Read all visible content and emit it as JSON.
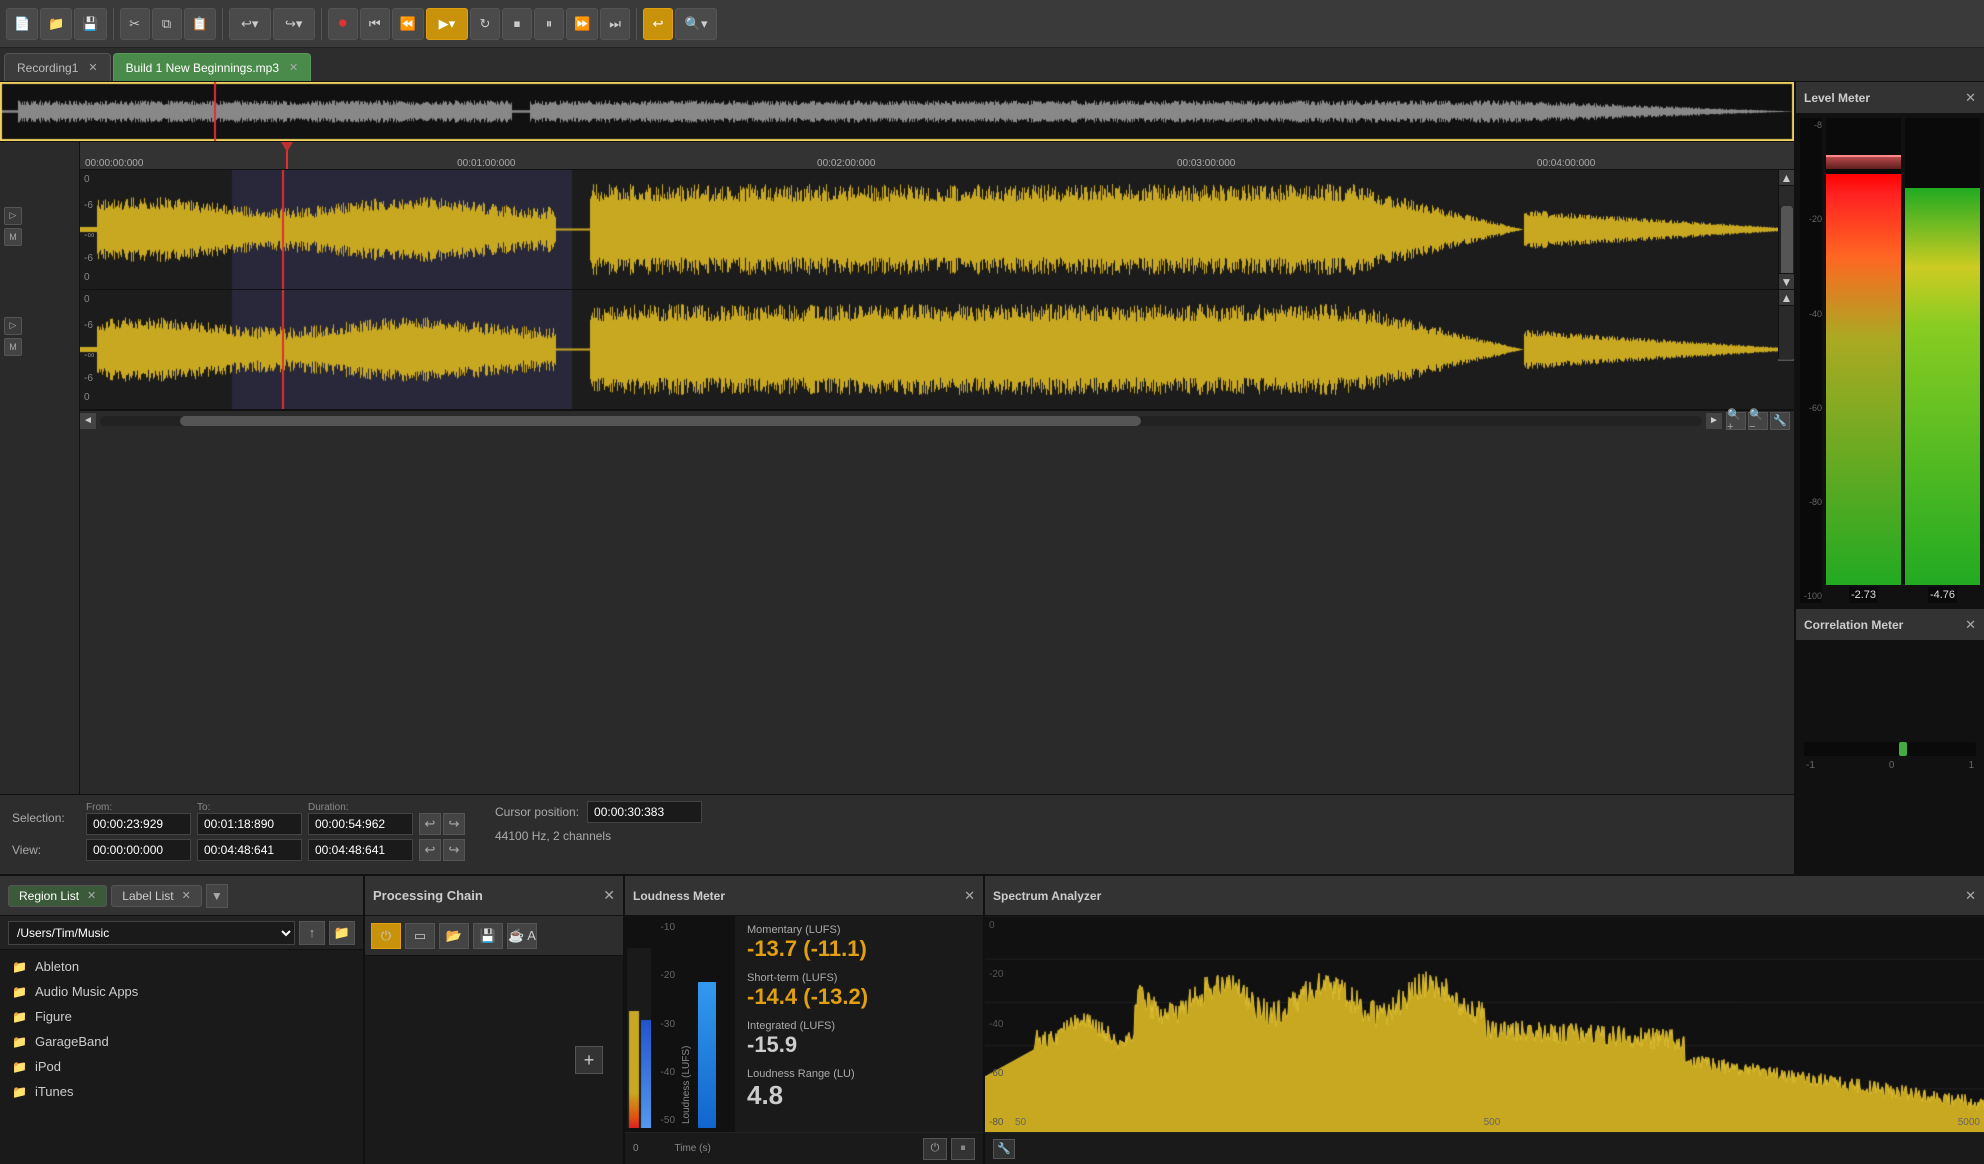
{
  "toolbar": {
    "new_label": "📄▾",
    "open_label": "📁",
    "save_label": "💾",
    "cut_label": "✂",
    "copy_label": "⧉",
    "paste_label": "📋",
    "undo_label": "↩",
    "undo_step_label": "↩▾",
    "redo_label": "↪",
    "redo_step_label": "↪▾",
    "record_label": "⏺",
    "skip_start_label": "⏮",
    "rewind_label": "⏪",
    "play_label": "▶▾",
    "loop_label": "↻",
    "stop_label": "⏹",
    "pause_label": "⏸",
    "fwd_label": "⏩",
    "skip_end_label": "⏭",
    "return_label": "↩",
    "zoom_label": "🔍▾"
  },
  "tabs": [
    {
      "id": "recording1",
      "label": "Recording1",
      "active": false
    },
    {
      "id": "build1",
      "label": "Build 1 New Beginnings.mp3",
      "active": true
    }
  ],
  "timeline": {
    "markers": [
      "00:00:00:000",
      "00:01:00:000",
      "00:02:00:000",
      "00:03:00:000",
      "00:04:00:000"
    ]
  },
  "selection": {
    "label": "Selection:",
    "view_label": "View:",
    "from_label": "From:",
    "to_label": "To:",
    "duration_label": "Duration:",
    "from_value": "00:00:23:929",
    "to_value": "00:01:18:890",
    "duration_value": "00:00:54:962",
    "view_from": "00:00:00:000",
    "view_to": "00:04:48:641",
    "view_duration": "00:04:48:641",
    "cursor_label": "Cursor position:",
    "cursor_value": "00:00:30:383",
    "sample_info": "44100 Hz, 2 channels"
  },
  "panels": {
    "region_list": {
      "title": "Region List",
      "label_list_title": "Label List",
      "path": "/Users/Tim/Music",
      "files": [
        {
          "name": "Ableton",
          "type": "folder"
        },
        {
          "name": "Audio Music Apps",
          "type": "folder"
        },
        {
          "name": "Figure",
          "type": "folder"
        },
        {
          "name": "GarageBand",
          "type": "folder"
        },
        {
          "name": "iPod",
          "type": "folder"
        },
        {
          "name": "iTunes",
          "type": "folder"
        }
      ]
    },
    "processing_chain": {
      "title": "Processing Chain"
    },
    "loudness_meter": {
      "title": "Loudness Meter",
      "momentary_label": "Momentary (LUFS)",
      "momentary_value": "-13.7 (-11.1)",
      "short_term_label": "Short-term (LUFS)",
      "short_term_value": "-14.4 (-13.2)",
      "integrated_label": "Integrated (LUFS)",
      "integrated_value": "-15.9",
      "range_label": "Loudness Range (LU)",
      "range_value": "4.8",
      "scale_values": [
        "-10",
        "-20",
        "-30",
        "-40",
        "-50"
      ],
      "time_label": "Time (s)",
      "x_label_zero": "0"
    },
    "spectrum_analyzer": {
      "title": "Spectrum Analyzer",
      "y_labels": [
        "0",
        "-20",
        "-40",
        "-60",
        "-80"
      ],
      "x_labels": [
        "50",
        "500",
        "5000"
      ]
    }
  },
  "level_meter": {
    "title": "Level Meter",
    "scale": [
      "-8",
      "-20",
      "-40",
      "-60",
      "-80",
      "-100"
    ],
    "left_value": "-2.73",
    "right_value": "-4.76",
    "left_fill_pct": 88,
    "right_fill_pct": 85,
    "left_peak_pct": 89,
    "right_peak_pct": 86
  },
  "correlation_meter": {
    "title": "Correlation Meter",
    "indicator_pos_pct": 58,
    "labels": [
      "-1",
      "0",
      "1"
    ]
  },
  "colors": {
    "accent_orange": "#c8920a",
    "wave_yellow": "#c8a820",
    "wave_dark": "#1c1c1c",
    "bg_dark": "#1a1a1a",
    "bg_mid": "#2a2a2a",
    "bg_light": "#3a3a3a",
    "green_meter": "#22aa22",
    "selection_highlight": "rgba(180,180,255,0.15)"
  }
}
